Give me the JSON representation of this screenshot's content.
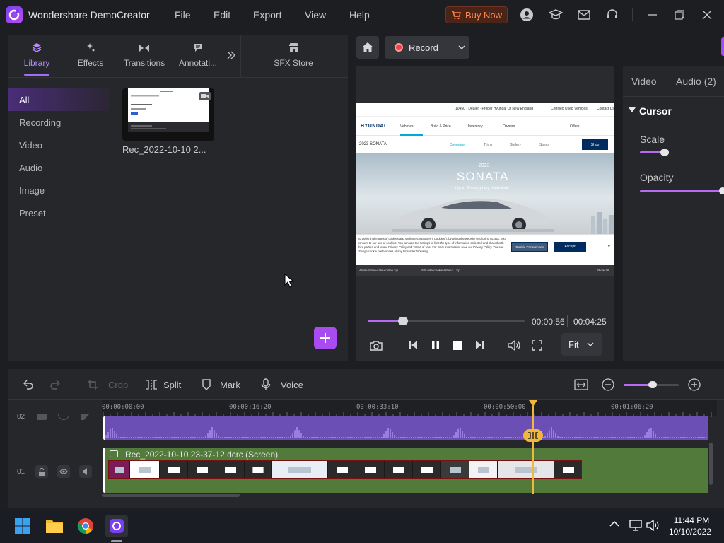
{
  "app": {
    "title": "Wondershare DemoCreator",
    "menu": [
      "File",
      "Edit",
      "Export",
      "View",
      "Help"
    ],
    "buy_now": "Buy Now",
    "accent_color": "#a84cf2"
  },
  "library": {
    "tabs": [
      {
        "label": "Library",
        "icon": "library-icon",
        "active": true
      },
      {
        "label": "Effects",
        "icon": "effects-icon"
      },
      {
        "label": "Transitions",
        "icon": "transitions-icon"
      },
      {
        "label": "Annotati...",
        "icon": "annotation-icon"
      },
      {
        "label": "SFX Store",
        "icon": "store-icon"
      }
    ],
    "sidebar": [
      "All",
      "Recording",
      "Video",
      "Audio",
      "Image",
      "Preset"
    ],
    "active_sidebar": "All",
    "media": [
      {
        "name": "Rec_2022-10-10 2...",
        "type": "video"
      }
    ]
  },
  "recorder": {
    "record_label": "Record"
  },
  "preview": {
    "time_current": "00:00:56",
    "time_total": "00:04:25",
    "playback_progress": 0.21,
    "fit_label": "Fit",
    "web": {
      "location": "10450 · Dealer · Proper Hyundai Of New England",
      "links_top": [
        "Certified Used Vehicles",
        "Contact Us"
      ],
      "brand": "HYUNDAI",
      "nav": [
        "Vehicles",
        "Build & Price",
        "Inventory",
        "Owners",
        "Offers"
      ],
      "model_bar": "2023 SONATA",
      "model_tabs": [
        "Overview",
        "Trims",
        "Gallery",
        "Specs"
      ],
      "shop_button": "Shop",
      "hero_year": "2023",
      "hero_title": "SONATA",
      "hero_sub": "Up to 50 mpg hwy. New look.",
      "cookie_text": "To assist in the uses of cookies and similar technologies (\"Cookies\"), by using the website or clicking Accept, you consent to our use of cookies. You can use the settings to limit the type of information collected and shared with third parties and to our Privacy Policy and Terms of Use. For more information, read our Privacy Policy. You can change cookie preferences at any time after browsing.",
      "cookie_pref": "Cookie Preferences",
      "cookie_accept": "Accept",
      "download_left": "Ammunition-sale-cookie.zip",
      "download_right": "SIR-site-cookie-label-c...zip",
      "show_all": "Show all"
    }
  },
  "properties": {
    "tabs": [
      "Video",
      "Audio (2)"
    ],
    "section": "Cursor",
    "scale_label": "Scale",
    "scale_value": 0.3,
    "opacity_label": "Opacity",
    "opacity_value": 1.0
  },
  "timeline": {
    "toolbar": {
      "crop": "Crop",
      "split": "Split",
      "mark": "Mark",
      "voice": "Voice",
      "zoom_level": 0.5
    },
    "ruler_labels": [
      "00:00:00:00",
      "00:00:16:20",
      "00:00:33:10",
      "00:00:50:00",
      "00:01:06:20"
    ],
    "track_numbers": [
      "01",
      "02"
    ],
    "video_clip_title": "Rec_2022-10-10 23-37-12.dcrc (Screen)",
    "audio_track_color": "#6b4fb5",
    "video_track_color": "#527a3a",
    "playhead_color": "#f2b83b"
  },
  "taskbar": {
    "apps": [
      "start-icon",
      "file-explorer-icon",
      "chrome-icon",
      "democreator-icon"
    ],
    "time": "11:44 PM",
    "date": "10/10/2022"
  }
}
